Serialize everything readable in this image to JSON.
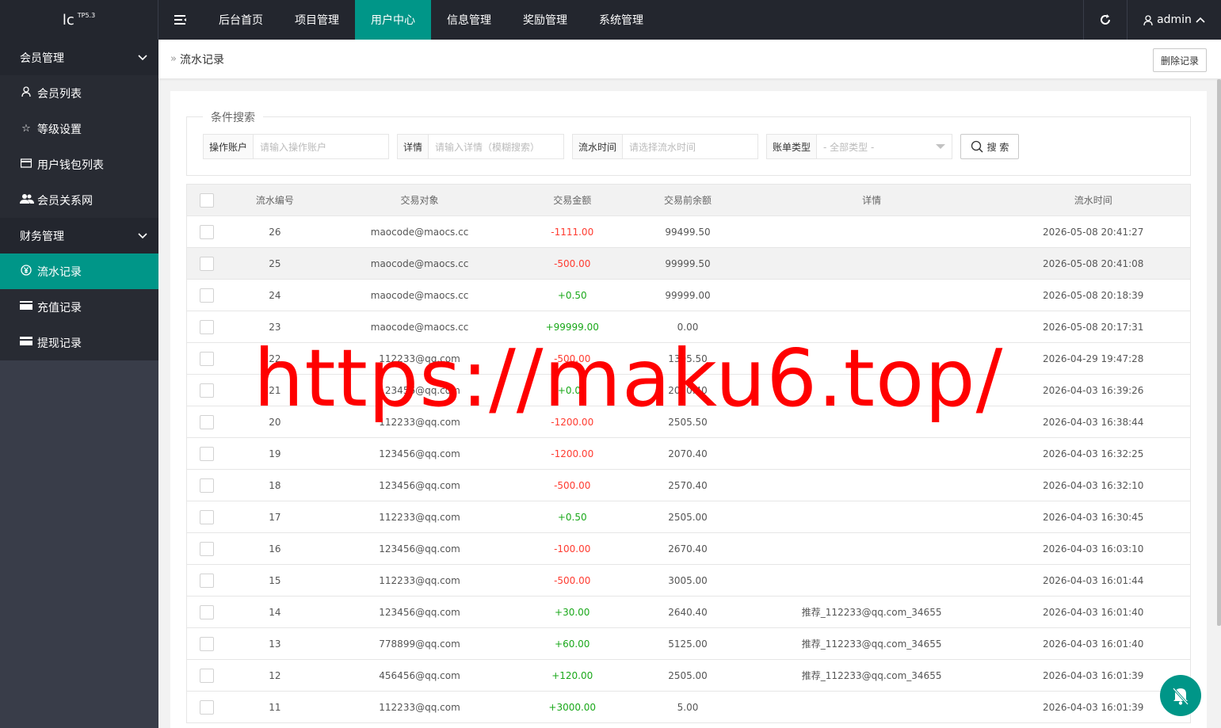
{
  "logo": {
    "main": "lc",
    "version": "TP5.3"
  },
  "nav": {
    "items": [
      {
        "label": "后台首页",
        "active": false
      },
      {
        "label": "项目管理",
        "active": false
      },
      {
        "label": "用户中心",
        "active": true
      },
      {
        "label": "信息管理",
        "active": false
      },
      {
        "label": "奖励管理",
        "active": false
      },
      {
        "label": "系统管理",
        "active": false
      }
    ]
  },
  "user": {
    "name": "admin"
  },
  "sidebar": {
    "groups": [
      {
        "label": "会员管理",
        "items": [
          {
            "label": "会员列表",
            "icon": "user-icon"
          },
          {
            "label": "等级设置",
            "icon": "star-icon"
          },
          {
            "label": "用户钱包列表",
            "icon": "wallet-icon"
          },
          {
            "label": "会员关系网",
            "icon": "users-icon"
          }
        ]
      },
      {
        "label": "财务管理",
        "items": [
          {
            "label": "流水记录",
            "icon": "yen-icon",
            "active": true
          },
          {
            "label": "充值记录",
            "icon": "card-icon"
          },
          {
            "label": "提现记录",
            "icon": "card-icon"
          }
        ]
      }
    ]
  },
  "breadcrumb": {
    "current": "流水记录"
  },
  "toolbar": {
    "delete_label": "删除记录"
  },
  "search": {
    "legend": "条件搜索",
    "account_label": "操作账户",
    "account_placeholder": "请输入操作账户",
    "detail_label": "详情",
    "detail_placeholder": "请输入详情（模糊搜索）",
    "time_label": "流水时间",
    "time_placeholder": "请选择流水时间",
    "type_label": "账单类型",
    "type_selected": "- 全部类型 -",
    "button_label": "搜 索"
  },
  "table": {
    "columns": [
      "流水编号",
      "交易对象",
      "交易金额",
      "交易前余额",
      "详情",
      "流水时间"
    ],
    "rows": [
      {
        "id": "26",
        "target": "maocode@maocs.cc",
        "amount": "-1111.00",
        "before": "99499.50",
        "detail": "",
        "time": "2026-05-08 20:41:27"
      },
      {
        "id": "25",
        "target": "maocode@maocs.cc",
        "amount": "-500.00",
        "before": "99999.50",
        "detail": "",
        "time": "2026-05-08 20:41:08"
      },
      {
        "id": "24",
        "target": "maocode@maocs.cc",
        "amount": "+0.50",
        "before": "99999.00",
        "detail": "",
        "time": "2026-05-08 20:18:39"
      },
      {
        "id": "23",
        "target": "maocode@maocs.cc",
        "amount": "+99999.00",
        "before": "0.00",
        "detail": "",
        "time": "2026-05-08 20:17:31"
      },
      {
        "id": "22",
        "target": "112233@qq.com",
        "amount": "-500.00",
        "before": "1305.50",
        "detail": "",
        "time": "2026-04-29 19:47:28"
      },
      {
        "id": "21",
        "target": "123456@qq.com",
        "amount": "+0.00",
        "before": "2070.40",
        "detail": "",
        "time": "2026-04-03 16:39:26"
      },
      {
        "id": "20",
        "target": "112233@qq.com",
        "amount": "-1200.00",
        "before": "2505.50",
        "detail": "",
        "time": "2026-04-03 16:38:44"
      },
      {
        "id": "19",
        "target": "123456@qq.com",
        "amount": "-1200.00",
        "before": "2070.40",
        "detail": "",
        "time": "2026-04-03 16:32:25"
      },
      {
        "id": "18",
        "target": "123456@qq.com",
        "amount": "-500.00",
        "before": "2570.40",
        "detail": "",
        "time": "2026-04-03 16:32:10"
      },
      {
        "id": "17",
        "target": "112233@qq.com",
        "amount": "+0.50",
        "before": "2505.00",
        "detail": "",
        "time": "2026-04-03 16:30:45"
      },
      {
        "id": "16",
        "target": "123456@qq.com",
        "amount": "-100.00",
        "before": "2670.40",
        "detail": "",
        "time": "2026-04-03 16:03:10"
      },
      {
        "id": "15",
        "target": "112233@qq.com",
        "amount": "-500.00",
        "before": "3005.00",
        "detail": "",
        "time": "2026-04-03 16:01:44"
      },
      {
        "id": "14",
        "target": "123456@qq.com",
        "amount": "+30.00",
        "before": "2640.40",
        "detail": "推荐_112233@qq.com_34655",
        "time": "2026-04-03 16:01:40"
      },
      {
        "id": "13",
        "target": "778899@qq.com",
        "amount": "+60.00",
        "before": "5125.00",
        "detail": "推荐_112233@qq.com_34655",
        "time": "2026-04-03 16:01:40"
      },
      {
        "id": "12",
        "target": "456456@qq.com",
        "amount": "+120.00",
        "before": "2505.00",
        "detail": "推荐_112233@qq.com_34655",
        "time": "2026-04-03 16:01:39"
      },
      {
        "id": "11",
        "target": "112233@qq.com",
        "amount": "+3000.00",
        "before": "5.00",
        "detail": "",
        "time": "2026-04-03 16:01:39"
      }
    ]
  },
  "watermark": {
    "text": "https://maku6.top/"
  },
  "colors": {
    "accent": "#009688",
    "negative": "#ff3b30",
    "positive": "#1aa81a",
    "header": "#23262e"
  }
}
